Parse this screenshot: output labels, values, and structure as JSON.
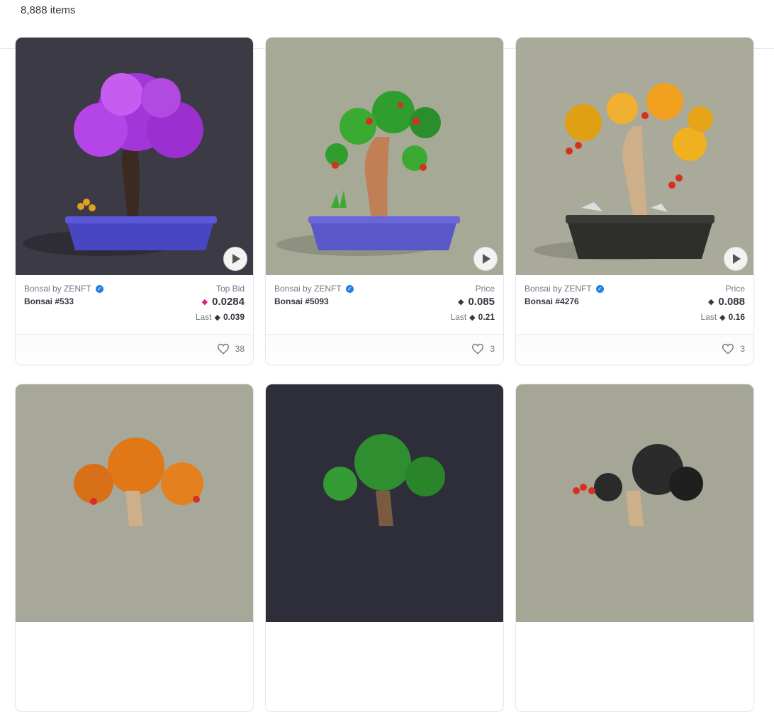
{
  "header": {
    "item_count": "8,888 items"
  },
  "cards": [
    {
      "collection": "Bonsai by ZENFT",
      "name": "Bonsai #533",
      "price_label": "Top Bid",
      "price": "0.0284",
      "last_label": "Last",
      "last": "0.039",
      "likes": "38",
      "price_icon": "weth-icon"
    },
    {
      "collection": "Bonsai by ZENFT",
      "name": "Bonsai #5093",
      "price_label": "Price",
      "price": "0.085",
      "last_label": "Last",
      "last": "0.21",
      "likes": "3",
      "price_icon": "eth-icon"
    },
    {
      "collection": "Bonsai by ZENFT",
      "name": "Bonsai #4276",
      "price_label": "Price",
      "price": "0.088",
      "last_label": "Last",
      "last": "0.16",
      "likes": "3",
      "price_icon": "eth-icon"
    }
  ],
  "colors": {
    "verified": "#2081e2",
    "weth": "#e0217a",
    "text_secondary": "#707a83"
  }
}
